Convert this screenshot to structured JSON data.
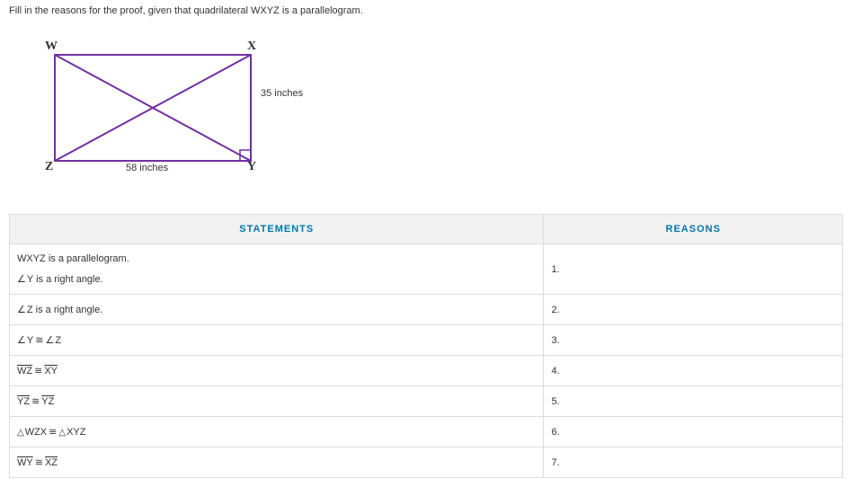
{
  "instruction": "Fill in the reasons for the proof, given that quadrilateral WXYZ is a parallelogram.",
  "diagram": {
    "W": "W",
    "X": "X",
    "Y": "Y",
    "Z": "Z",
    "side_xy": "35 inches",
    "side_zy": "58 inches"
  },
  "headers": {
    "statements": "STATEMENTS",
    "reasons": "REASONS"
  },
  "statements": {
    "s1a": "WXYZ is a parallelogram.",
    "s1b_pre": "Y",
    "s1b_post": " is a right angle.",
    "s2_pre": "Z",
    "s2_post": " is a right angle.",
    "s3_a": "Y",
    "s3_b": "Z",
    "s4_a": "WZ",
    "s4_b": "XY",
    "s5_a": "YZ",
    "s5_b": "YZ",
    "s6_a": "WZX",
    "s6_b": "XYZ",
    "s7_a": "WY",
    "s7_b": "XZ"
  },
  "reasons": {
    "n1": "1.",
    "n2": "2.",
    "n3": "3.",
    "n4": "4.",
    "n5": "5.",
    "n6": "6.",
    "n7": "7."
  }
}
